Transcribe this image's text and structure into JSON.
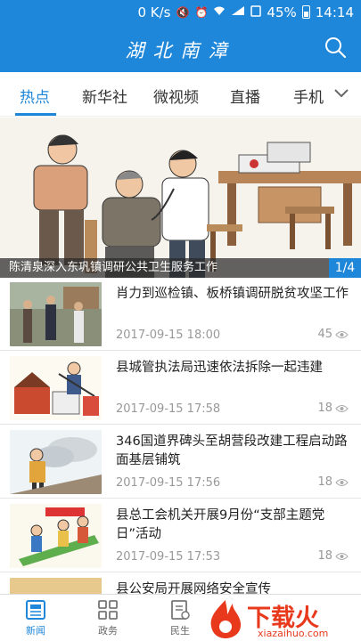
{
  "status_bar": {
    "network_speed": "0 K/s",
    "battery": "45%",
    "time": "14:14",
    "icons": [
      "mute-icon",
      "alarm-icon",
      "wifi-icon",
      "signal-icon",
      "battery-icon"
    ]
  },
  "header": {
    "title": "湖北南漳",
    "brand_color": "#1f87d9"
  },
  "tabs": [
    {
      "label": "热点",
      "active": true
    },
    {
      "label": "新华社",
      "active": false
    },
    {
      "label": "微视频",
      "active": false
    },
    {
      "label": "直播",
      "active": false
    },
    {
      "label": "手机",
      "active": false
    }
  ],
  "carousel": {
    "caption": "陈清泉深入东巩镇调研公共卫生服务工作",
    "counter": "1/4"
  },
  "news": [
    {
      "title": "肖力到巡检镇、板桥镇调研脱贫攻坚工作",
      "date": "2017-09-15 18:00",
      "views": "45"
    },
    {
      "title": "县城管执法局迅速依法拆除一起违建",
      "date": "2017-09-15 17:58",
      "views": "18"
    },
    {
      "title": "346国道界碑头至胡营段改建工程启动路面基层铺筑",
      "date": "2017-09-15 17:56",
      "views": "18"
    },
    {
      "title": "县总工会机关开展9月份“支部主题党日”活动",
      "date": "2017-09-15 17:53",
      "views": "18"
    },
    {
      "title": "县公安局开展网络安全宣传",
      "date": "",
      "views": ""
    }
  ],
  "bottom_nav": [
    {
      "label": "新闻",
      "icon": "newspaper-icon",
      "active": true
    },
    {
      "label": "政务",
      "icon": "grid-icon",
      "active": false
    },
    {
      "label": "民生",
      "icon": "document-icon",
      "active": false
    }
  ],
  "watermark": {
    "text": "下载火",
    "url": "xiazaihuo.com"
  }
}
